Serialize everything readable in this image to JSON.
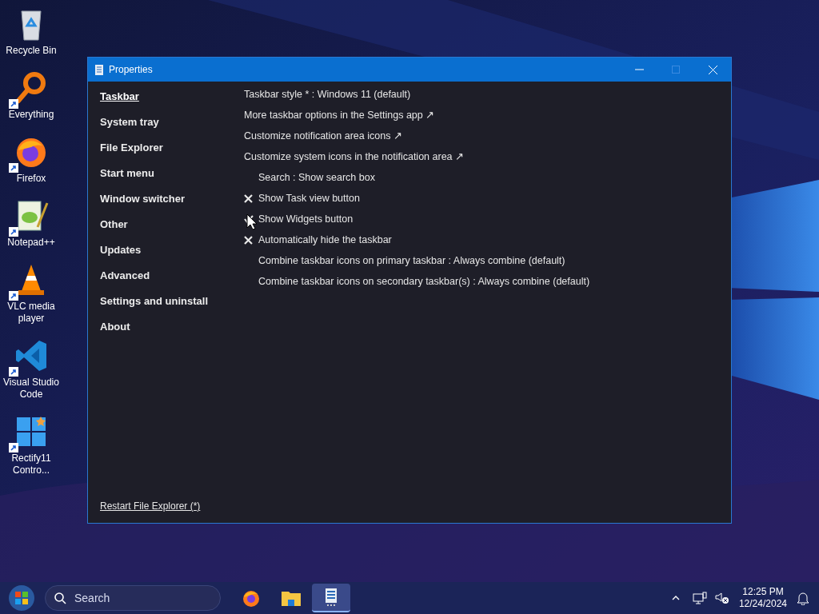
{
  "desktop_icons": [
    {
      "label": "Recycle Bin",
      "shortcut": false
    },
    {
      "label": "Everything",
      "shortcut": true
    },
    {
      "label": "Firefox",
      "shortcut": true
    },
    {
      "label": "Notepad++",
      "shortcut": true
    },
    {
      "label": "VLC media player",
      "shortcut": true
    },
    {
      "label": "Visual Studio Code",
      "shortcut": true
    },
    {
      "label": "Rectify11 Contro...",
      "shortcut": true
    }
  ],
  "window": {
    "title": "Properties",
    "maximize_disabled": true,
    "sidebar": {
      "items": [
        {
          "label": "Taskbar",
          "selected": true
        },
        {
          "label": "System tray",
          "selected": false
        },
        {
          "label": "File Explorer",
          "selected": false
        },
        {
          "label": "Start menu",
          "selected": false
        },
        {
          "label": "Window switcher",
          "selected": false
        },
        {
          "label": "Other",
          "selected": false
        },
        {
          "label": "Updates",
          "selected": false
        },
        {
          "label": "Advanced",
          "selected": false
        },
        {
          "label": "Settings and uninstall",
          "selected": false
        },
        {
          "label": "About",
          "selected": false
        }
      ],
      "footer_link": "Restart File Explorer (*)"
    },
    "options": [
      {
        "kind": "choice",
        "label": "Taskbar style * : Windows 11 (default)"
      },
      {
        "kind": "link",
        "label": "More taskbar options in the Settings app ↗"
      },
      {
        "kind": "link",
        "label": "Customize notification area icons ↗"
      },
      {
        "kind": "link",
        "label": "Customize system icons in the notification area ↗"
      },
      {
        "kind": "sub-choice",
        "label": "Search : Show search box"
      },
      {
        "kind": "toggle",
        "checked": false,
        "label": "Show Task view button"
      },
      {
        "kind": "toggle",
        "checked": true,
        "label": "Show Widgets button"
      },
      {
        "kind": "toggle",
        "checked": false,
        "label": "Automatically hide the taskbar"
      },
      {
        "kind": "sub-choice",
        "label": "Combine taskbar icons on primary taskbar : Always combine (default)"
      },
      {
        "kind": "sub-choice",
        "label": "Combine taskbar icons on secondary taskbar(s) : Always combine (default)"
      }
    ]
  },
  "taskbar": {
    "search": {
      "placeholder": "Search"
    },
    "apps": [
      {
        "selected": false
      },
      {
        "selected": false
      },
      {
        "selected": true
      }
    ],
    "clock": {
      "time": "12:25 PM",
      "date": "12/24/2024"
    }
  }
}
